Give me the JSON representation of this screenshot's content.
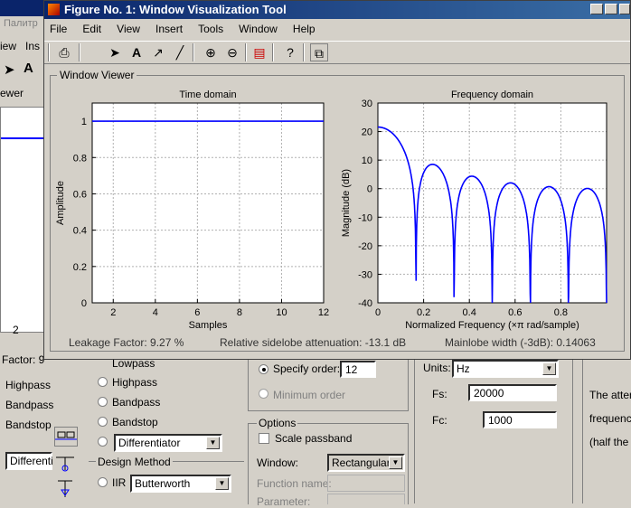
{
  "figure": {
    "title": "Figure No. 1: Window Visualization Tool",
    "menu": [
      "File",
      "Edit",
      "View",
      "Insert",
      "Tools",
      "Window",
      "Help"
    ],
    "panel_label": "Window Viewer",
    "leakage": "Leakage Factor: 9.27 %",
    "sidelobe": "Relative sidelobe attenuation: -13.1 dB",
    "mainlobe": "Mainlobe width (-3dB): 0.14063"
  },
  "background": {
    "title_fragment": "Палитр",
    "menu_fragments": [
      "iew",
      "Ins"
    ],
    "plot_label_fragment": "ewer",
    "tick_fragment": "2",
    "factor_fragment": "Factor: 9",
    "lowpass_frag": "Lowpass",
    "left_list": [
      "Highpass",
      "Bandpass",
      "Bandstop"
    ],
    "left_combo": "Differenti",
    "response_options": [
      "Lowpass",
      "Highpass",
      "Bandpass",
      "Bandstop"
    ],
    "differentiator": "Differentiator",
    "design_method_label": "Design Method",
    "iir_label": "IIR",
    "iir_combo": "Butterworth",
    "specify_order": "Specify order:",
    "order_value": "12",
    "minimum_order": "Minimum order",
    "options_label": "Options",
    "scale_passband": "Scale passband",
    "window_label": "Window:",
    "window_value": "Rectangular",
    "function_name": "Function name:",
    "parameter": "Parameter:",
    "units_label": "Units:",
    "units_value": "Hz",
    "fs_label": "Fs:",
    "fs_value": "20000",
    "fc_label": "Fc:",
    "fc_value": "1000",
    "right_text": [
      "The atten",
      "frequencie",
      "(half the p"
    ]
  },
  "chart_data": [
    {
      "type": "line",
      "title": "Time domain",
      "xlabel": "Samples",
      "ylabel": "Amplitude",
      "xlim": [
        1,
        12
      ],
      "ylim": [
        0,
        1.1
      ],
      "xticks": [
        2,
        4,
        6,
        8,
        10,
        12
      ],
      "yticks": [
        0,
        0.2,
        0.4,
        0.6,
        0.8,
        1
      ],
      "grid": true,
      "color": "#0000ff",
      "series": [
        {
          "x": [
            1,
            2,
            3,
            4,
            5,
            6,
            7,
            8,
            9,
            10,
            11,
            12
          ],
          "y": [
            1,
            1,
            1,
            1,
            1,
            1,
            1,
            1,
            1,
            1,
            1,
            1
          ]
        }
      ]
    },
    {
      "type": "line",
      "title": "Frequency domain",
      "xlabel": "Normalized Frequency  (×π rad/sample)",
      "ylabel": "Magnitude (dB)",
      "xlim": [
        0,
        1
      ],
      "ylim": [
        -40,
        30
      ],
      "xticks": [
        0,
        0.2,
        0.4,
        0.6,
        0.8
      ],
      "yticks": [
        -40,
        -30,
        -20,
        -10,
        0,
        10,
        20,
        30
      ],
      "grid": true,
      "color": "#0000ff",
      "window_length": 12
    }
  ]
}
